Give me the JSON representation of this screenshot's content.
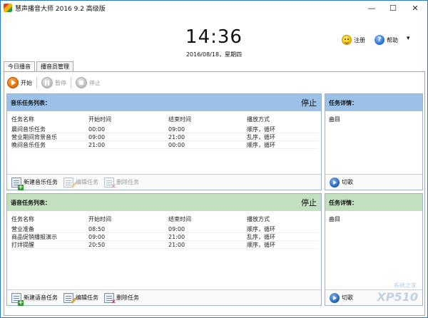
{
  "window": {
    "title": "慧声播音大师 2016 9.2 高级版",
    "min_glyph": "—",
    "max_glyph": "☐",
    "close_glyph": "✕"
  },
  "clock": {
    "time": "14:36",
    "date": "2016/08/18，星期四"
  },
  "top_actions": {
    "register_label": "注册",
    "help_label": "帮助",
    "dropdown_glyph": "▾"
  },
  "tabs": [
    {
      "label": "今日播音"
    },
    {
      "label": "播音员管理"
    }
  ],
  "toolbar": {
    "start_label": "开始",
    "pause_label": "暂停",
    "stop_label": "停止"
  },
  "music_panel": {
    "title": "音乐任务列表：",
    "status": "停止",
    "columns": [
      "任务名称",
      "开始时间",
      "结束时间",
      "播放方式"
    ],
    "rows": [
      {
        "name": "晨间音乐任务",
        "start": "00:00",
        "end": "09:00",
        "mode": "顺序，循环"
      },
      {
        "name": "营业期间背景音乐",
        "start": "09:00",
        "end": "21:00",
        "mode": "乱序，循环"
      },
      {
        "name": "晚间音乐任务",
        "start": "21:00",
        "end": "00:00",
        "mode": "顺序，循环"
      }
    ],
    "footer": {
      "new_label": "新建音乐任务",
      "edit_label": "编辑任务",
      "delete_label": "删除任务"
    }
  },
  "music_detail": {
    "title": "任务详情：",
    "sub": "曲目",
    "cut_label": "切歌"
  },
  "voice_panel": {
    "title": "语音任务列表：",
    "status": "停止",
    "columns": [
      "任务名称",
      "开始时间",
      "结束时间",
      "播放方式"
    ],
    "rows": [
      {
        "name": "营业准备",
        "start": "08:50",
        "end": "09:00",
        "mode": "顺序，循环"
      },
      {
        "name": "商品促销播报演示",
        "start": "09:00",
        "end": "21:00",
        "mode": "乱序，循环"
      },
      {
        "name": "打烊提醒",
        "start": "20:50",
        "end": "21:00",
        "mode": "顺序，循环"
      }
    ],
    "footer": {
      "new_label": "新建语音任务",
      "edit_label": "编辑任务",
      "delete_label": "删除任务"
    }
  },
  "voice_detail": {
    "title": "任务详情：",
    "sub": "曲目",
    "cut_label": "切歌"
  },
  "watermark": {
    "main": "XP510",
    "site": "系统之家"
  }
}
